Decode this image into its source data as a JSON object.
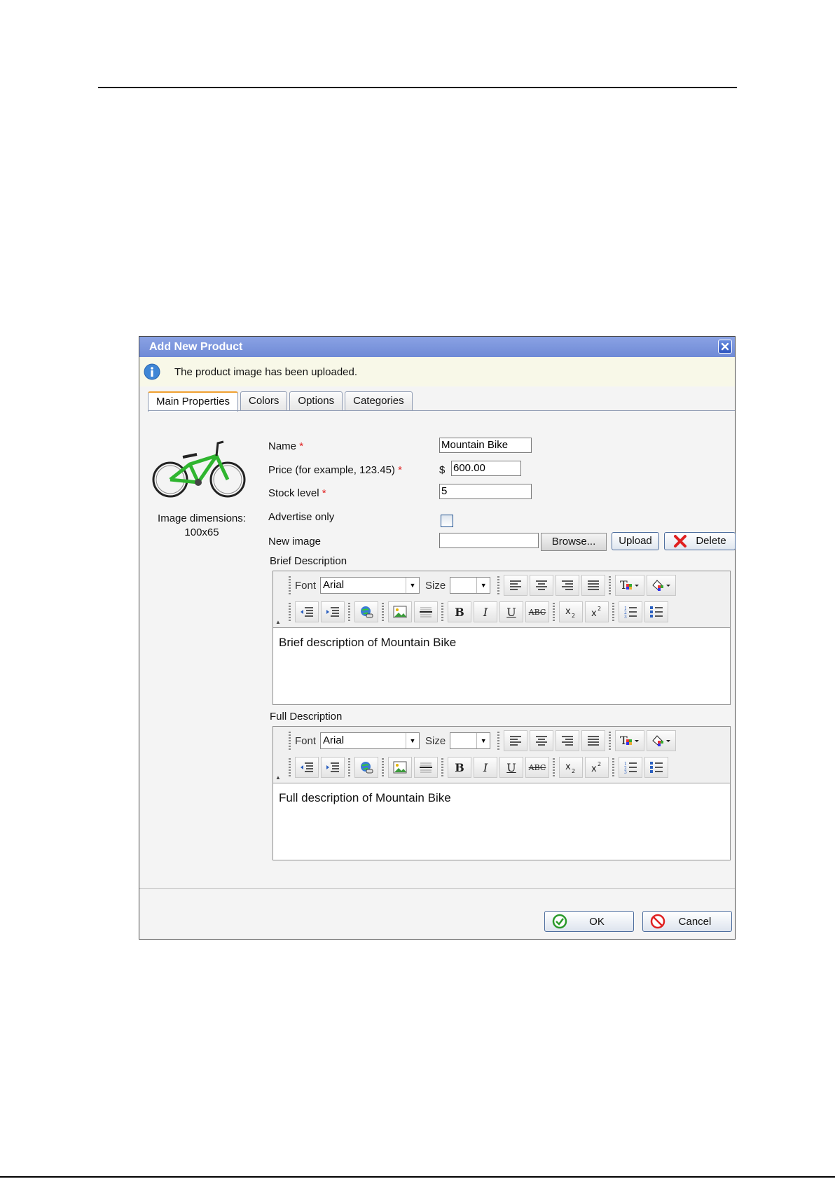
{
  "dialog": {
    "title": "Add New Product",
    "info_message": "The product image has been uploaded."
  },
  "tabs": [
    {
      "label": "Main Properties",
      "active": true
    },
    {
      "label": "Colors",
      "active": false
    },
    {
      "label": "Options",
      "active": false
    },
    {
      "label": "Categories",
      "active": false
    }
  ],
  "image": {
    "caption_line1": "Image dimensions:",
    "caption_line2": "100x65"
  },
  "form": {
    "name_label": "Name",
    "name_value": "Mountain Bike",
    "price_label": "Price (for example, 123.45)",
    "currency": "$",
    "price_value": "600.00",
    "stock_label": "Stock level",
    "stock_value": "5",
    "advertise_label": "Advertise only",
    "new_image_label": "New image",
    "browse_label": "Browse...",
    "upload_label": "Upload",
    "delete_label": "Delete",
    "required_mark": "*"
  },
  "brief": {
    "label": "Brief Description",
    "content": "Brief description of Mountain Bike"
  },
  "full": {
    "label": "Full Description",
    "content": "Full description of Mountain Bike"
  },
  "toolbar": {
    "font_label": "Font",
    "font_value": "Arial",
    "size_label": "Size",
    "size_value": "",
    "bold": "B",
    "italic": "I",
    "underline": "U",
    "strike": "ABC"
  },
  "footer": {
    "ok_label": "OK",
    "cancel_label": "Cancel"
  },
  "colors": {
    "titlebar": "#7b95dd",
    "required": "#e02020",
    "tab_active_accent": "#f0a030"
  }
}
